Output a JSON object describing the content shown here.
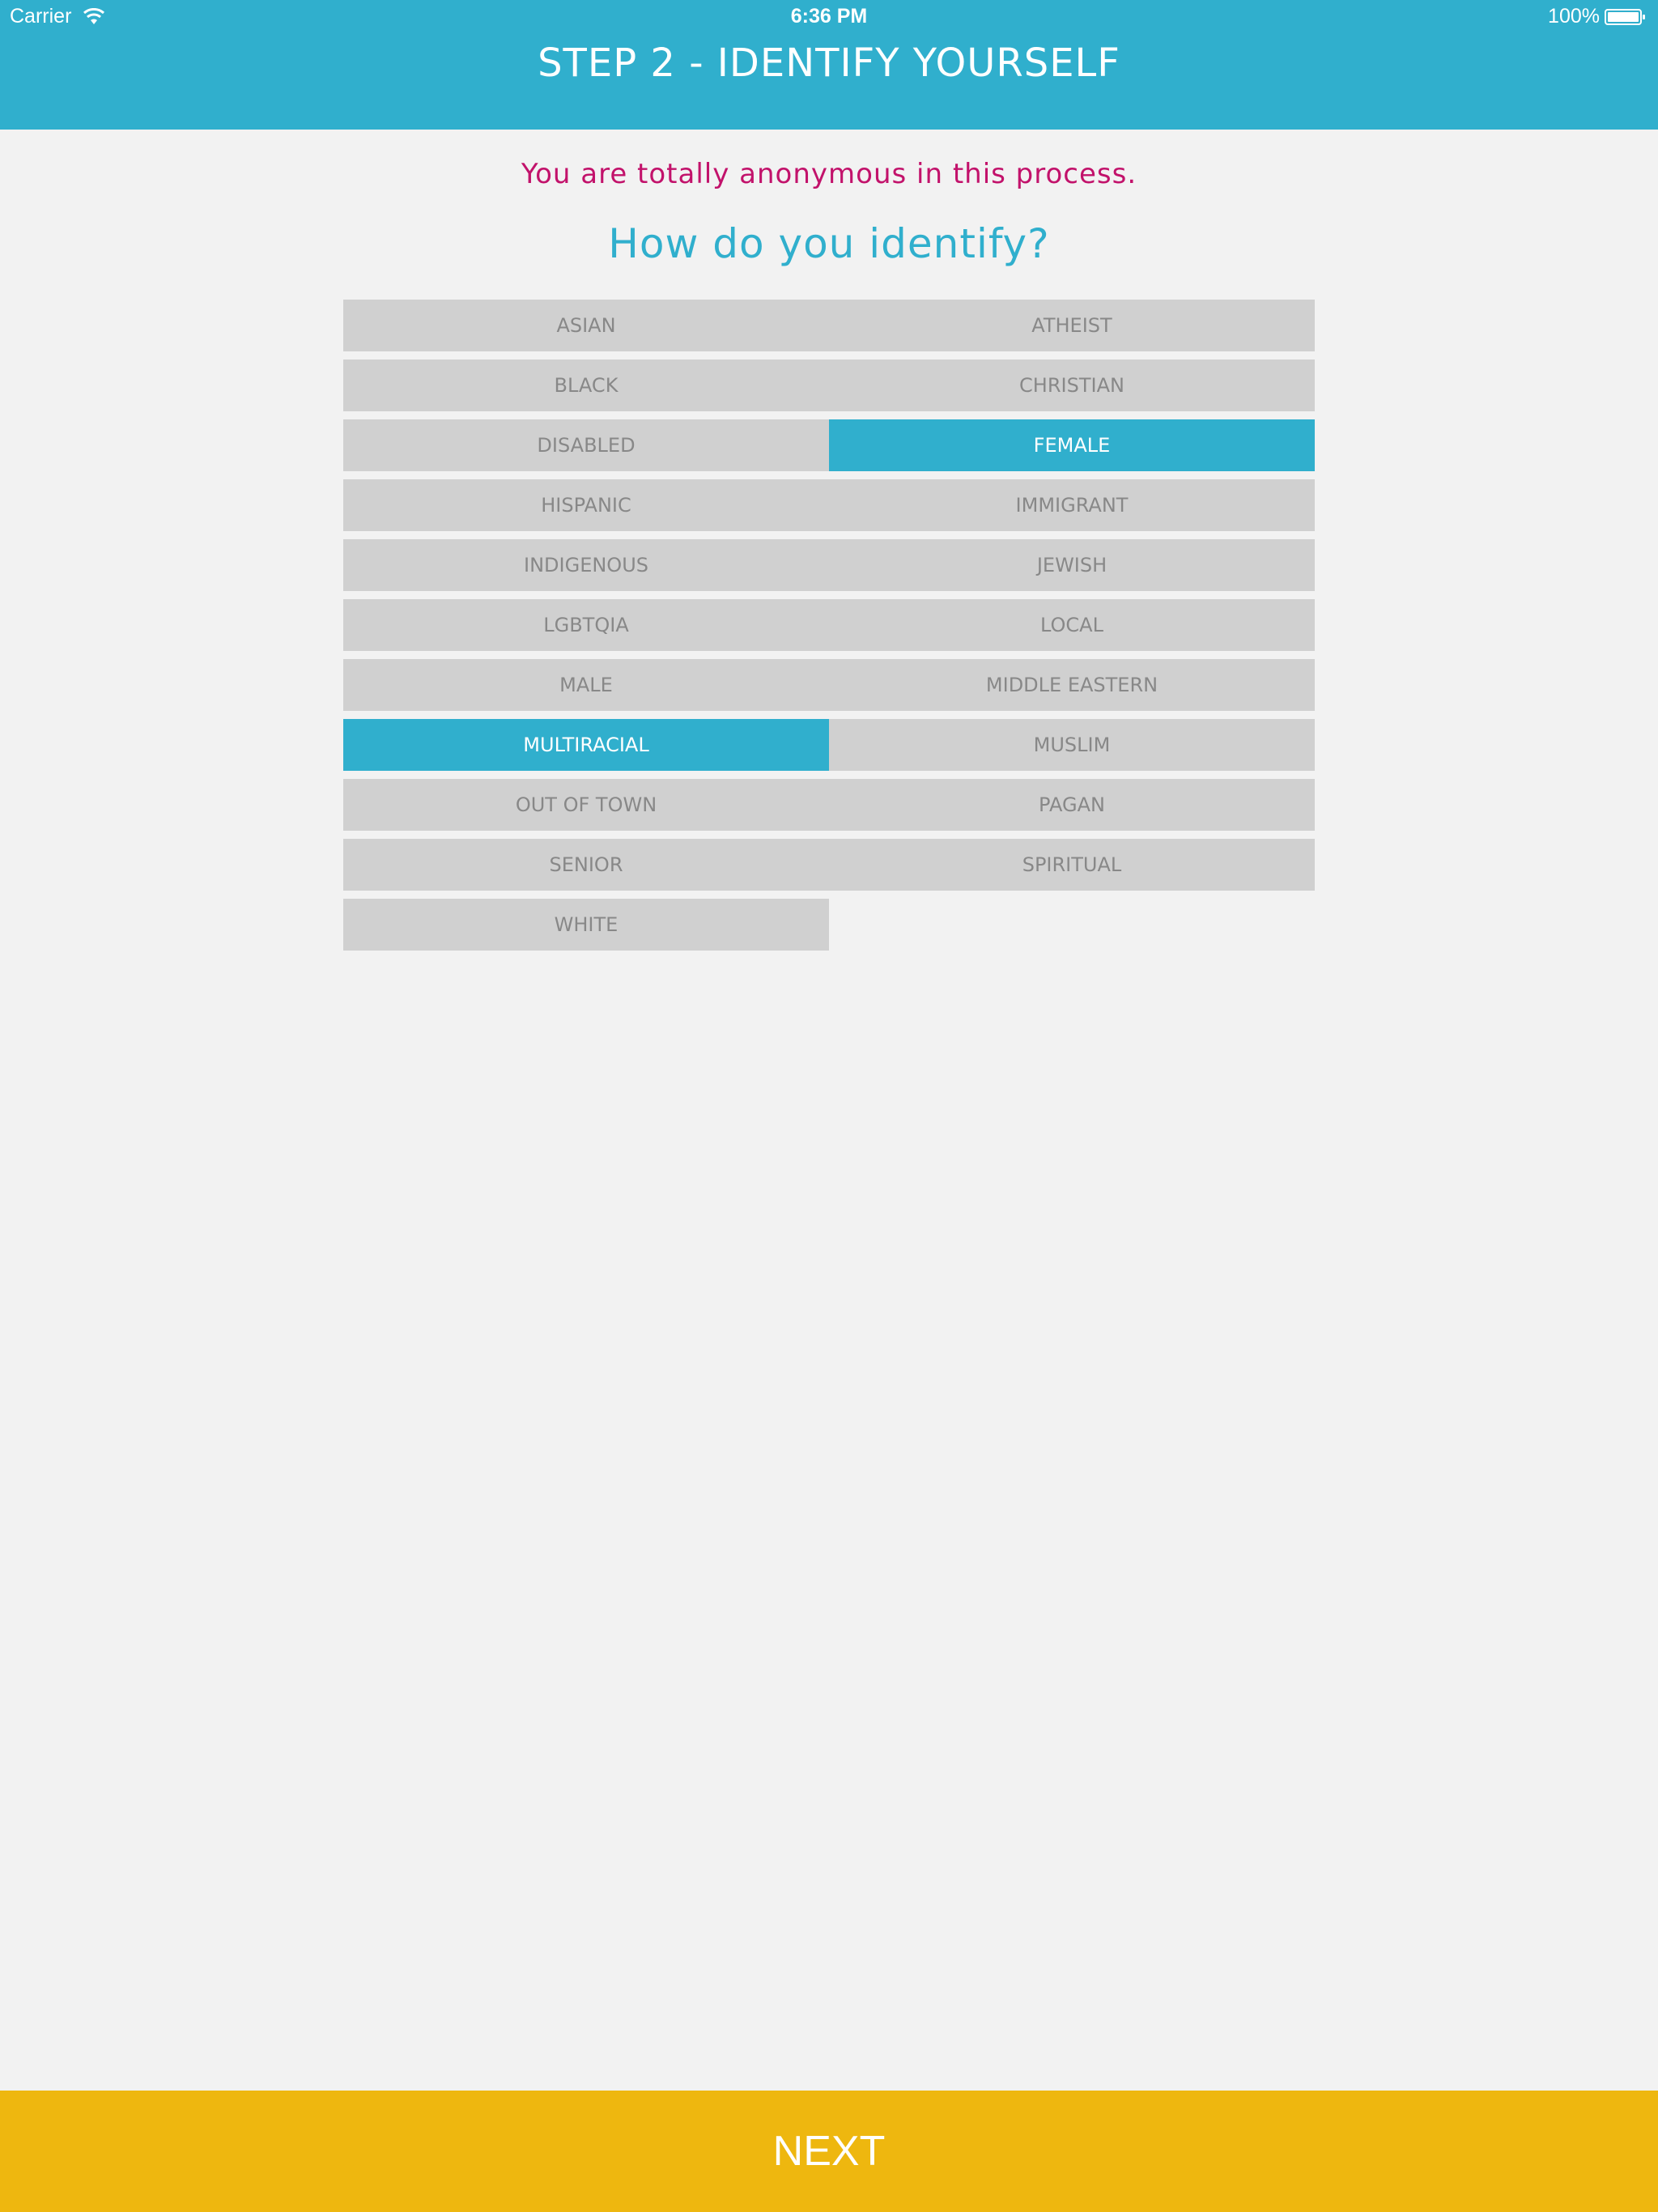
{
  "colors": {
    "accent": "#30afcd",
    "subtitle": "#c2126b",
    "next": "#eeb70f",
    "option_bg": "#d0d0d0",
    "option_text": "#888888",
    "background": "#f2f2f2"
  },
  "status_bar": {
    "carrier": "Carrier",
    "time": "6:36 PM",
    "battery": "100%",
    "icons": [
      "wifi-icon",
      "battery-icon"
    ]
  },
  "header": {
    "title": "STEP 2 - IDENTIFY YOURSELF"
  },
  "main": {
    "subtitle": "You are totally anonymous in this process.",
    "question": "How do you identify?",
    "options": [
      {
        "label": "ASIAN",
        "selected": false
      },
      {
        "label": "ATHEIST",
        "selected": false
      },
      {
        "label": "BLACK",
        "selected": false
      },
      {
        "label": "CHRISTIAN",
        "selected": false
      },
      {
        "label": "DISABLED",
        "selected": false
      },
      {
        "label": "FEMALE",
        "selected": true
      },
      {
        "label": "HISPANIC",
        "selected": false
      },
      {
        "label": "IMMIGRANT",
        "selected": false
      },
      {
        "label": "INDIGENOUS",
        "selected": false
      },
      {
        "label": "JEWISH",
        "selected": false
      },
      {
        "label": "LGBTQIA",
        "selected": false
      },
      {
        "label": "LOCAL",
        "selected": false
      },
      {
        "label": "MALE",
        "selected": false
      },
      {
        "label": "MIDDLE EASTERN",
        "selected": false
      },
      {
        "label": "MULTIRACIAL",
        "selected": true
      },
      {
        "label": "MUSLIM",
        "selected": false
      },
      {
        "label": "OUT OF TOWN",
        "selected": false
      },
      {
        "label": "PAGAN",
        "selected": false
      },
      {
        "label": "SENIOR",
        "selected": false
      },
      {
        "label": "SPIRITUAL",
        "selected": false
      },
      {
        "label": "WHITE",
        "selected": false
      }
    ]
  },
  "footer": {
    "next_label": "NEXT"
  }
}
